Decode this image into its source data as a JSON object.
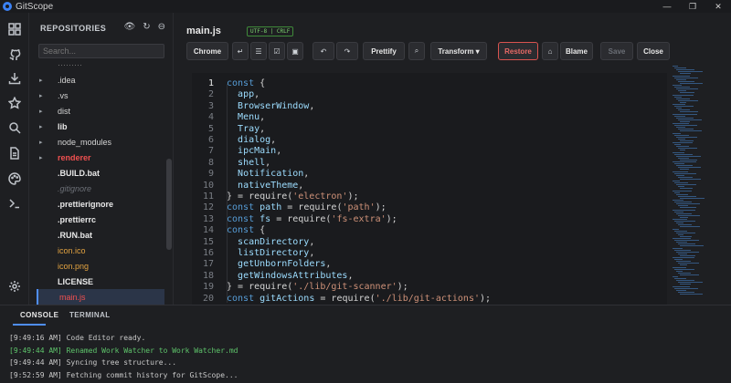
{
  "app": {
    "title": "GitScope",
    "window_controls": [
      "—",
      "❐",
      "✕"
    ]
  },
  "activity_bar": {
    "icons": [
      "grid-icon",
      "github-icon",
      "download-icon",
      "star-icon",
      "search-icon",
      "document-icon",
      "palette-icon",
      "terminal-icon",
      "settings-icon"
    ]
  },
  "sidebar": {
    "header": "REPOSITORIES",
    "tools": [
      "eye-icon",
      "refresh-icon",
      "collapse-icon"
    ],
    "search_placeholder": "Search...",
    "items": [
      {
        "label": "·········",
        "type": "partial"
      },
      {
        "label": ".idea",
        "type": "folder"
      },
      {
        "label": ".vs",
        "type": "folder"
      },
      {
        "label": "dist",
        "type": "folder"
      },
      {
        "label": "lib",
        "type": "folder",
        "style": "bold"
      },
      {
        "label": "node_modules",
        "type": "folder"
      },
      {
        "label": "renderer",
        "type": "folder",
        "style": "red"
      },
      {
        "label": ".BUILD.bat",
        "type": "file",
        "style": "bold"
      },
      {
        "label": ".gitignore",
        "type": "file",
        "style": "dim"
      },
      {
        "label": ".prettierignore",
        "type": "file",
        "style": "bold"
      },
      {
        "label": ".prettierrc",
        "type": "file",
        "style": "bold"
      },
      {
        "label": ".RUN.bat",
        "type": "file",
        "style": "bold"
      },
      {
        "label": "icon.ico",
        "type": "file",
        "style": "orange"
      },
      {
        "label": "icon.png",
        "type": "file",
        "style": "orange"
      },
      {
        "label": "LICENSE",
        "type": "file",
        "style": "bold"
      },
      {
        "label": "main.js",
        "type": "file",
        "style": "active"
      }
    ]
  },
  "editor": {
    "file_title": "main.js",
    "badge": "UTF-8 | CRLF",
    "toolbar": {
      "chrome": "Chrome",
      "prettify": "Prettify",
      "transform": "Transform ▾",
      "restore": "Restore",
      "blame": "Blame",
      "save": "Save",
      "close": "Close"
    },
    "lines": [
      {
        "n": "1",
        "code": "const {"
      },
      {
        "n": "2",
        "code": "  app,"
      },
      {
        "n": "3",
        "code": "  BrowserWindow,"
      },
      {
        "n": "4",
        "code": "  Menu,"
      },
      {
        "n": "5",
        "code": "  Tray,"
      },
      {
        "n": "6",
        "code": "  dialog,"
      },
      {
        "n": "7",
        "code": "  ipcMain,"
      },
      {
        "n": "8",
        "code": "  shell,"
      },
      {
        "n": "9",
        "code": "  Notification,"
      },
      {
        "n": "10",
        "code": "  nativeTheme,"
      },
      {
        "n": "11",
        "code": "} = require('electron');"
      },
      {
        "n": "12",
        "code": "const path = require('path');"
      },
      {
        "n": "13",
        "code": "const fs = require('fs-extra');"
      },
      {
        "n": "14",
        "code": "const {"
      },
      {
        "n": "15",
        "code": "  scanDirectory,"
      },
      {
        "n": "16",
        "code": "  listDirectory,"
      },
      {
        "n": "17",
        "code": "  getUnbornFolders,"
      },
      {
        "n": "18",
        "code": "  getWindowsAttributes,"
      },
      {
        "n": "19",
        "code": "} = require('./lib/git-scanner');"
      },
      {
        "n": "20",
        "code": "const gitActions = require('./lib/git-actions');"
      }
    ]
  },
  "panel": {
    "tabs": [
      "CONSOLE",
      "TERMINAL"
    ],
    "logs": [
      {
        "text": "[9:49:16 AM] Code Editor ready.",
        "kind": "info"
      },
      {
        "text": "[9:49:44 AM] Renamed Work Watcher to Work Watcher.md",
        "kind": "success"
      },
      {
        "text": "[9:49:44 AM] Syncing tree structure...",
        "kind": "info"
      },
      {
        "text": "[9:52:59 AM] Fetching commit history for GitScope...",
        "kind": "info"
      }
    ]
  },
  "colors": {
    "accent": "#4f8ef7",
    "keyword": "#569cd6",
    "string": "#ce9178",
    "success": "#5ec46b",
    "error": "#f05050"
  }
}
